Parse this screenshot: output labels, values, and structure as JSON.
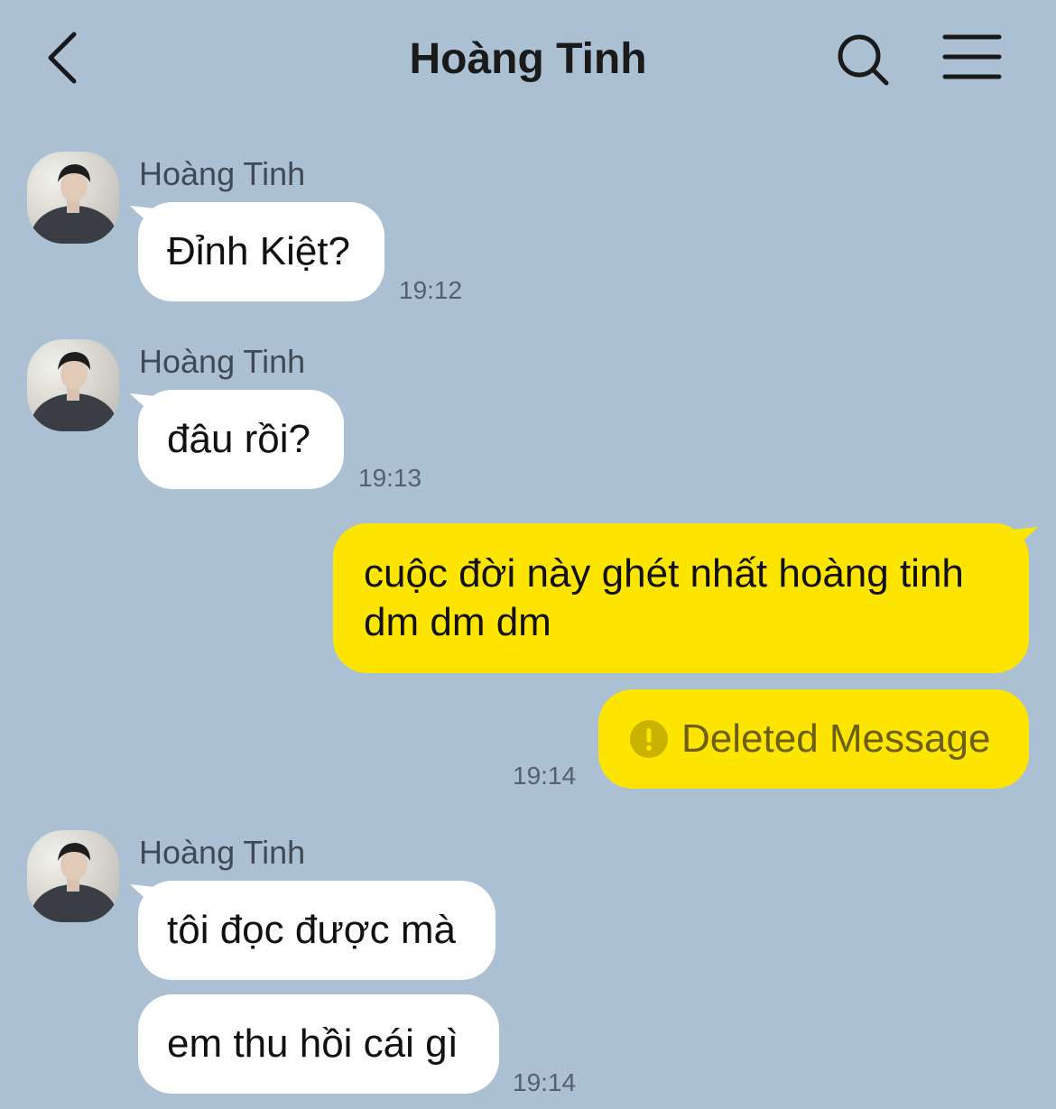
{
  "header": {
    "title": "Hoàng Tinh",
    "back_icon": "chevron-left-icon",
    "search_icon": "search-icon",
    "menu_icon": "hamburger-menu-icon"
  },
  "colors": {
    "background": "#abc1d3",
    "incoming_bubble": "#ffffff",
    "outgoing_bubble": "#fee500",
    "deleted_icon": "#c9b200"
  },
  "messages": [
    {
      "sender": "Hoàng Tinh",
      "text": "Đỉnh Kiệt?",
      "time": "19:12"
    },
    {
      "sender": "Hoàng Tinh",
      "text": "đâu rồi?",
      "time": "19:13"
    },
    {
      "outgoing": true,
      "line1": "cuộc đời này ghét nhất hoàng tinh",
      "line2": "dm dm dm"
    },
    {
      "outgoing": true,
      "deleted": true,
      "text": "Deleted Message",
      "time": "19:14",
      "icon": "exclamation-circle-icon"
    },
    {
      "sender": "Hoàng Tinh",
      "text": "tôi đọc được mà"
    },
    {
      "text": "em thu hồi cái gì",
      "time": "19:14"
    }
  ]
}
